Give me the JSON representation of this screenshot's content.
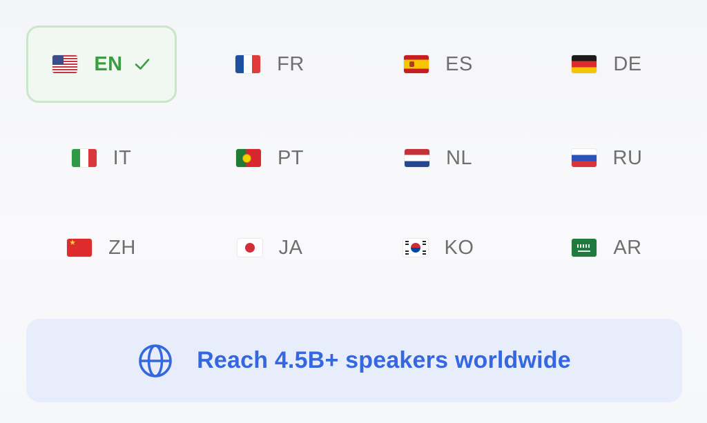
{
  "languages": [
    {
      "code": "EN",
      "flag": "us-flag-icon",
      "selected": true
    },
    {
      "code": "FR",
      "flag": "fr-flag-icon",
      "selected": false
    },
    {
      "code": "ES",
      "flag": "es-flag-icon",
      "selected": false
    },
    {
      "code": "DE",
      "flag": "de-flag-icon",
      "selected": false
    },
    {
      "code": "IT",
      "flag": "it-flag-icon",
      "selected": false
    },
    {
      "code": "PT",
      "flag": "pt-flag-icon",
      "selected": false
    },
    {
      "code": "NL",
      "flag": "nl-flag-icon",
      "selected": false
    },
    {
      "code": "RU",
      "flag": "ru-flag-icon",
      "selected": false
    },
    {
      "code": "ZH",
      "flag": "cn-flag-icon",
      "selected": false
    },
    {
      "code": "JA",
      "flag": "jp-flag-icon",
      "selected": false
    },
    {
      "code": "KO",
      "flag": "kr-flag-icon",
      "selected": false
    },
    {
      "code": "AR",
      "flag": "sa-flag-icon",
      "selected": false
    }
  ],
  "banner": {
    "text": "Reach 4.5B+ speakers worldwide",
    "icon": "globe-icon"
  },
  "colors": {
    "selected_text": "#3a9c43",
    "selected_border": "#c9e6cb",
    "selected_bg": "#f1f8f1",
    "code_text": "#6f6f6f",
    "banner_bg": "#e8edfb",
    "accent": "#3467e0"
  }
}
